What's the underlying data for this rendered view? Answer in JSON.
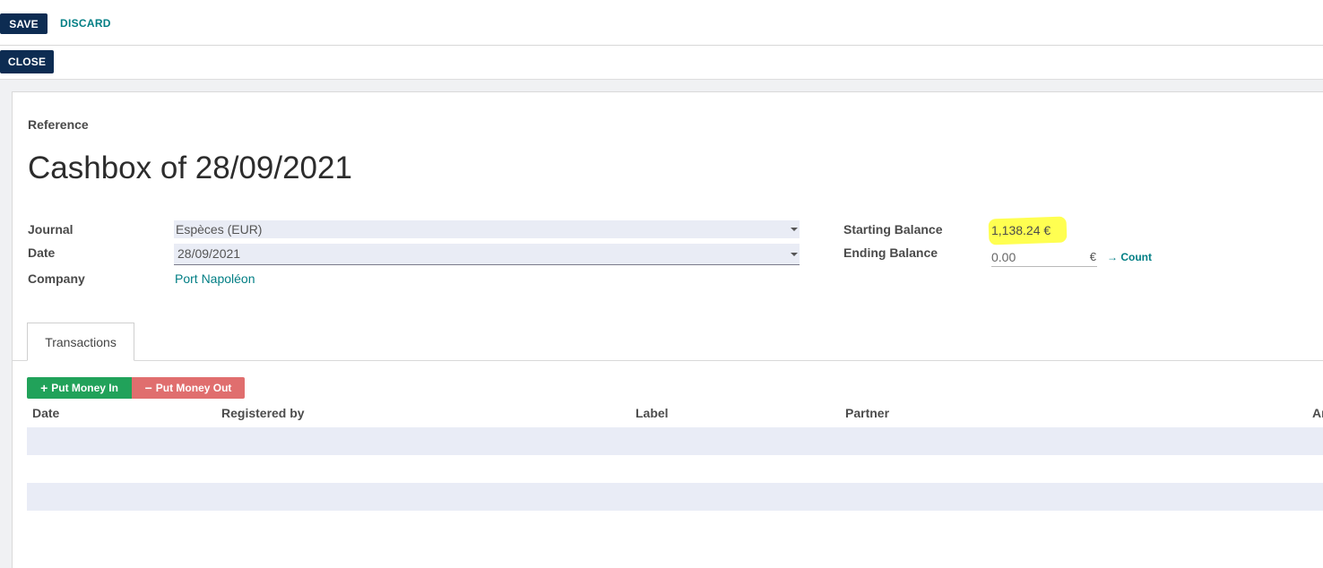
{
  "toolbar": {
    "save_label": "SAVE",
    "discard_label": "DISCARD",
    "close_label": "CLOSE"
  },
  "form": {
    "reference_label": "Reference",
    "title": "Cashbox of 28/09/2021",
    "journal_label": "Journal",
    "journal_value": "Espèces (EUR)",
    "date_label": "Date",
    "date_value": "28/09/2021",
    "company_label": "Company",
    "company_value": "Port Napoléon",
    "starting_balance_label": "Starting Balance",
    "starting_balance_value": "1,138.24 €",
    "ending_balance_label": "Ending Balance",
    "ending_balance_value": "0.00",
    "currency_symbol": "€",
    "count_label": "→ Count",
    "highlight_color": "#ffff33"
  },
  "tabs": [
    {
      "label": "Transactions"
    }
  ],
  "transactions": {
    "put_in_label": "Put Money In",
    "put_out_label": "Put Money Out",
    "columns": [
      "Date",
      "Registered by",
      "Label",
      "Partner",
      "Ar"
    ],
    "rows": []
  },
  "colors": {
    "primary": "#0d2c52",
    "link": "#017e84",
    "success": "#21a25a",
    "danger": "#e06e6e",
    "row_alt": "#e9ecf6"
  }
}
